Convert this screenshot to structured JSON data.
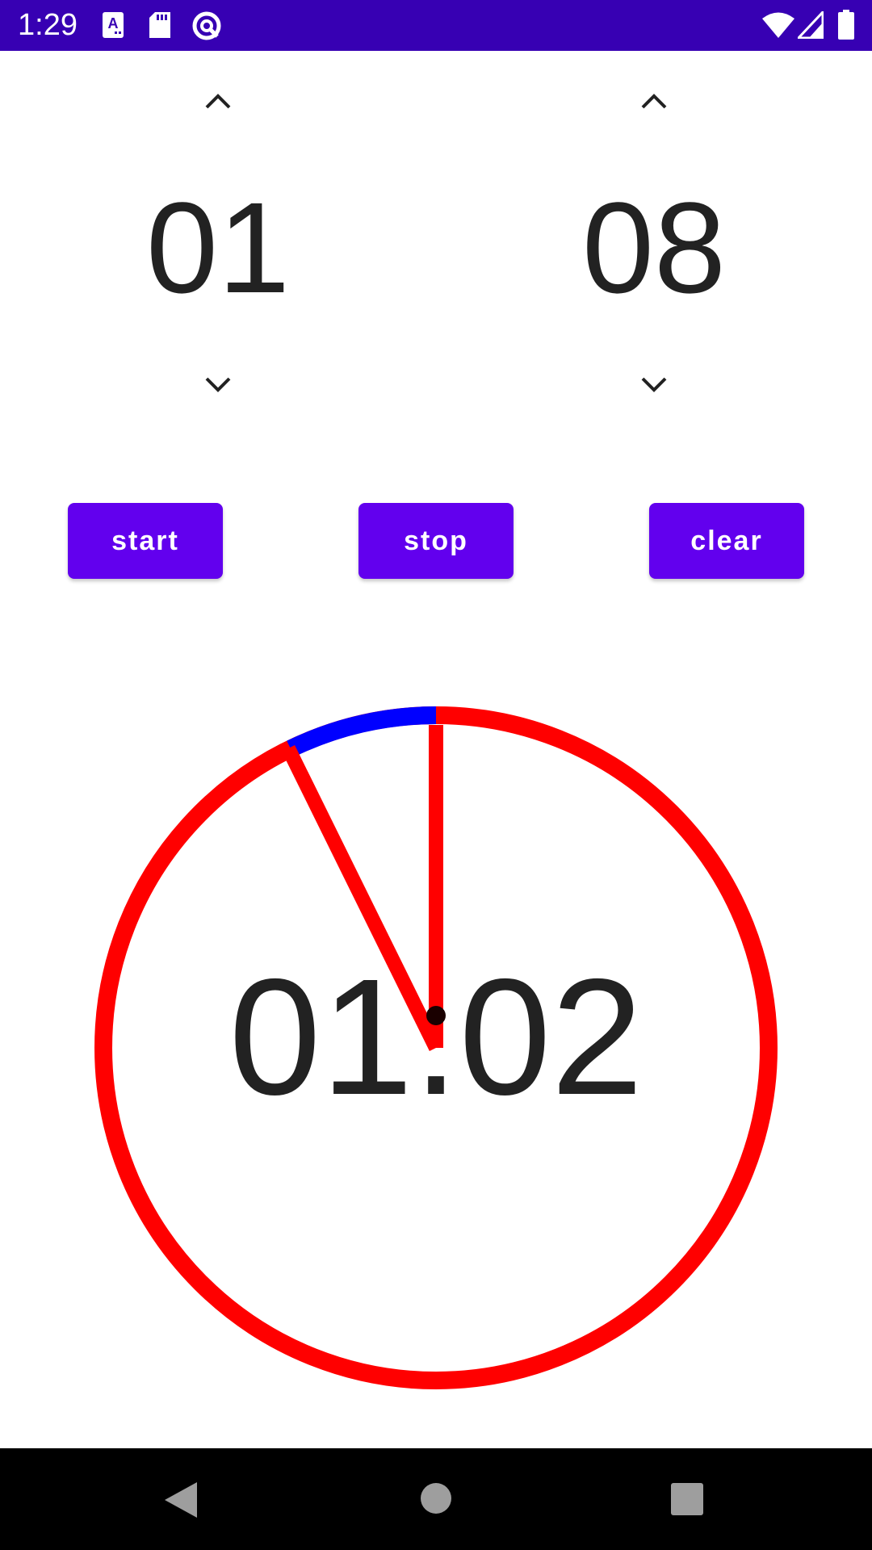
{
  "status_bar": {
    "time": "1:29",
    "background": "#3700b3",
    "icons": [
      "font-a-icon",
      "sd-card-icon",
      "circle-q-icon",
      "wifi-icon",
      "cellular-signal-icon",
      "battery-icon"
    ]
  },
  "pickers": {
    "minutes": {
      "value": "01",
      "up_icon": "chevron-up-icon",
      "down_icon": "chevron-down-icon"
    },
    "seconds": {
      "value": "08",
      "up_icon": "chevron-up-icon",
      "down_icon": "chevron-down-icon"
    }
  },
  "buttons": {
    "start_label": "start",
    "stop_label": "stop",
    "clear_label": "clear",
    "color": "#6200ee"
  },
  "timer": {
    "display": "01.02",
    "ring_color": "#ff0000",
    "elapsed_arc_color": "#0000ff",
    "hand_color": "#ff0000",
    "center_dot_color": "#1a0000"
  },
  "nav_bar": {
    "icons": [
      "back-icon",
      "home-icon",
      "recents-icon"
    ]
  }
}
